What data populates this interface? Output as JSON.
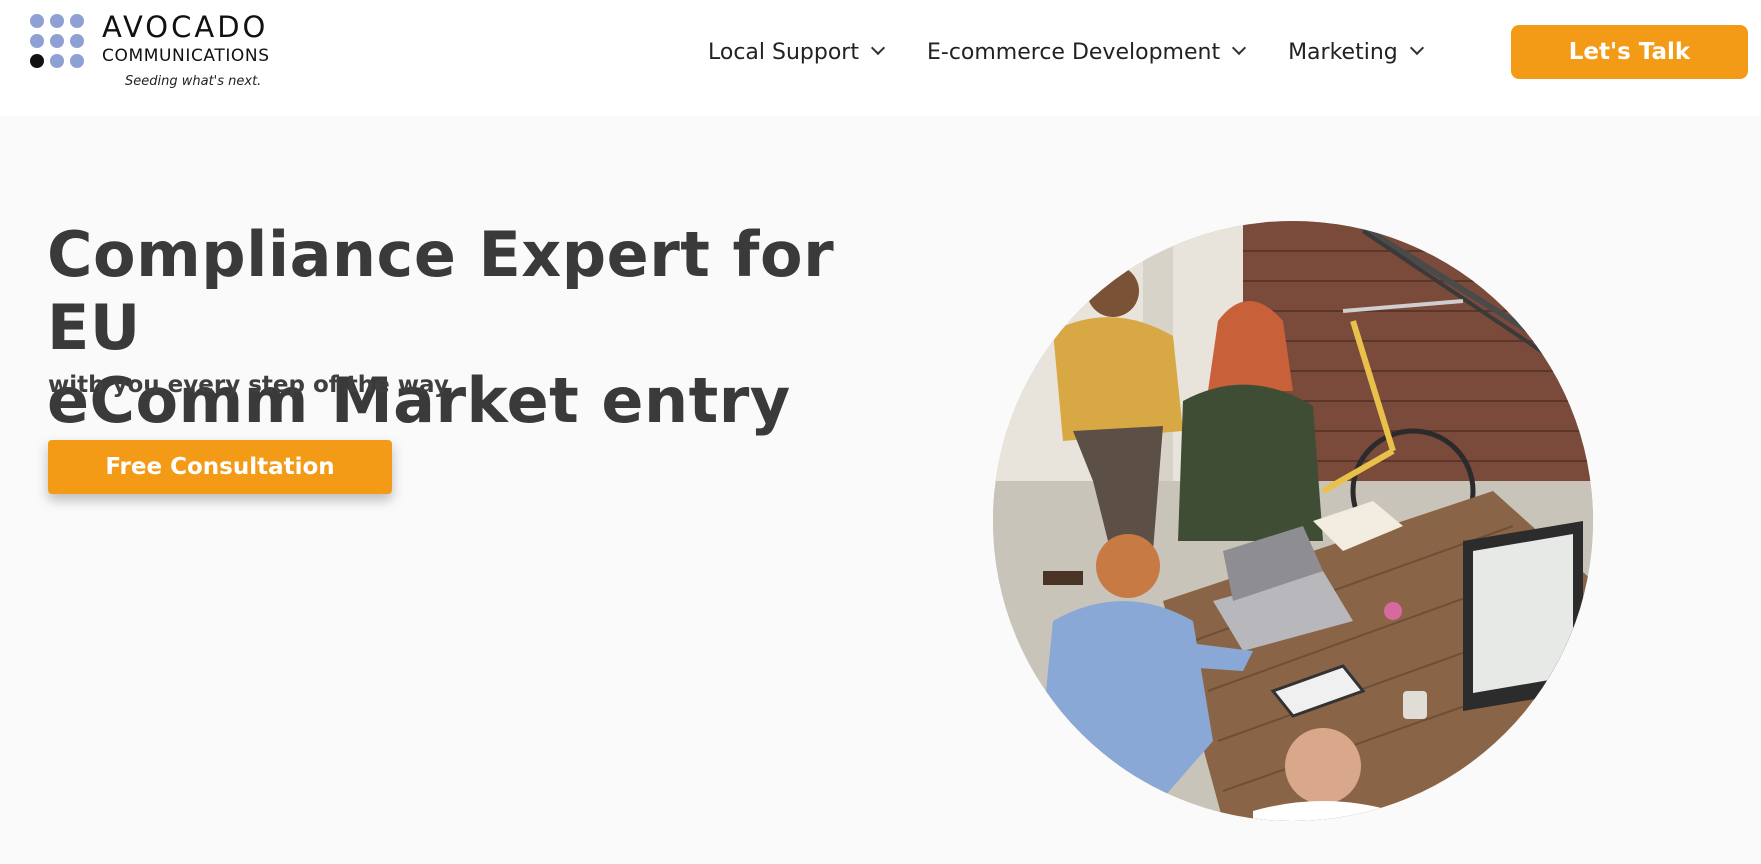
{
  "logo": {
    "brand_top": "AVOCADO",
    "brand_bottom": "COMMUNICATIONS",
    "tagline": "Seeding what's next."
  },
  "nav": {
    "items": [
      {
        "label": "Local Support",
        "icon": "chevron-down-icon"
      },
      {
        "label": "E-commerce Development",
        "icon": "chevron-down-icon"
      },
      {
        "label": "Marketing",
        "icon": "chevron-down-icon"
      }
    ],
    "cta_label": "Let's Talk"
  },
  "hero": {
    "title_line1": "Compliance Expert for EU",
    "title_line2": "eComm Market entry",
    "subtitle": "with you every step of the way",
    "cta_label": "Free Consultation"
  },
  "colors": {
    "accent": "#f39a16",
    "logo_dot": "#8fa0d4",
    "logo_dot_dark": "#111111",
    "background": "#fafafa",
    "header_bg": "#ffffff",
    "text": "#3a3a3a"
  }
}
